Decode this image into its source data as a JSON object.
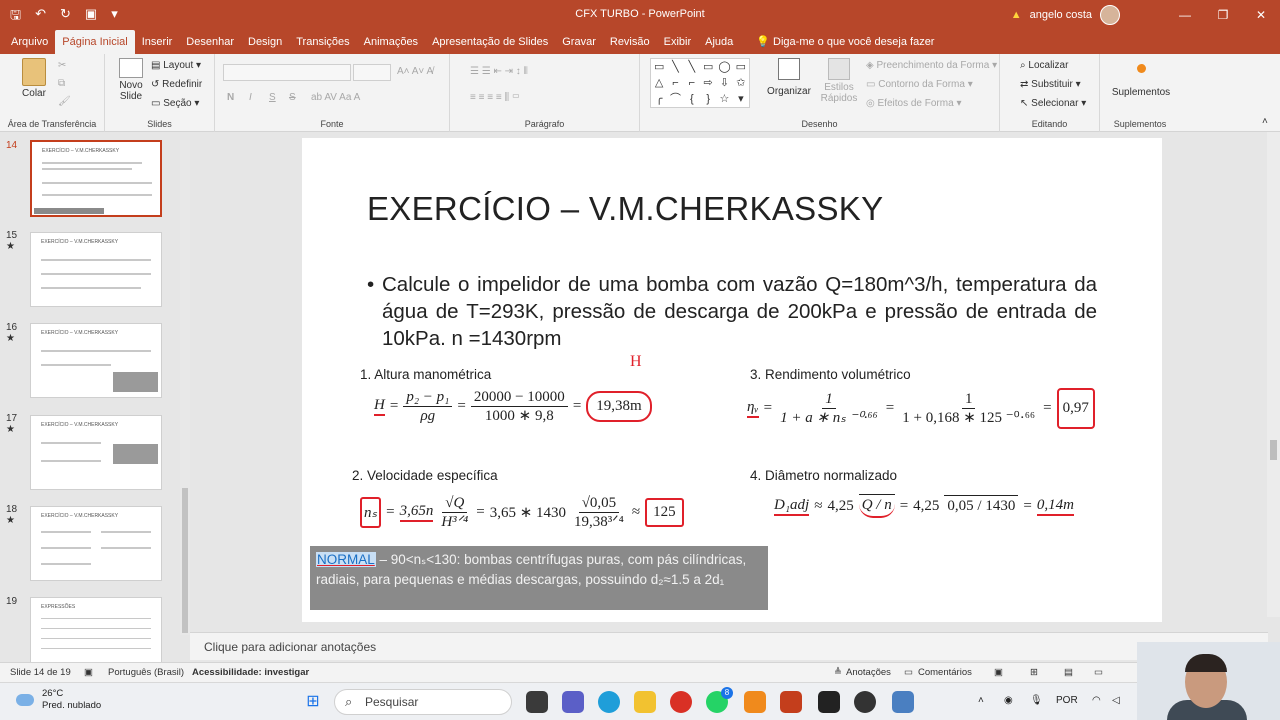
{
  "window": {
    "title": "CFX TURBO  -  PowerPoint",
    "user_name": "angelo costa"
  },
  "tabs": [
    {
      "label": "Arquivo"
    },
    {
      "label": "Página Inicial"
    },
    {
      "label": "Inserir"
    },
    {
      "label": "Desenhar"
    },
    {
      "label": "Design"
    },
    {
      "label": "Transições"
    },
    {
      "label": "Animações"
    },
    {
      "label": "Apresentação de Slides"
    },
    {
      "label": "Gravar"
    },
    {
      "label": "Revisão"
    },
    {
      "label": "Exibir"
    },
    {
      "label": "Ajuda"
    }
  ],
  "tell_me": "Diga-me o que você deseja fazer",
  "ribbon": {
    "clipboard": {
      "paste": "Colar",
      "group": "Área de Transferência"
    },
    "slides": {
      "new_slide": "Novo Slide",
      "layout": "Layout",
      "reset": "Redefinir",
      "section": "Seção",
      "group": "Slides"
    },
    "font": {
      "group": "Fonte",
      "bold": "N",
      "italic": "I",
      "underline": "S",
      "strike": "S"
    },
    "paragraph": {
      "group": "Parágrafo"
    },
    "drawing": {
      "arrange": "Organizar",
      "quick_styles": "Estilos Rápidos",
      "fill": "Preenchimento da Forma",
      "outline": "Contorno da Forma",
      "effects": "Efeitos de Forma",
      "group": "Desenho"
    },
    "editing": {
      "find": "Localizar",
      "replace": "Substituir",
      "select": "Selecionar",
      "group": "Editando"
    },
    "addins": {
      "label": "Suplementos",
      "group": "Suplementos"
    }
  },
  "thumbnails": [
    {
      "number": "14",
      "title": "EXERCÍCIO – V.M.CHERKASSKY"
    },
    {
      "number": "15",
      "title": "EXERCÍCIO – V.M.CHERKASSKY"
    },
    {
      "number": "16",
      "title": "EXERCÍCIO – V.M.CHERKASSKY"
    },
    {
      "number": "17",
      "title": "EXERCÍCIO – V.M.CHERKASSKY"
    },
    {
      "number": "18",
      "title": "EXERCÍCIO – V.M.CHERKASSKY"
    },
    {
      "number": "19",
      "title": "EXPRESSÕES"
    }
  ],
  "slide": {
    "title": "EXERCÍCIO – V.M.CHERKASSKY",
    "bullet": "Calcule o impelidor de uma bomba com vazão Q=180m^3/h, temperatura da água de T=293K, pressão de descarga de 200kPa e pressão de entrada de 10kPa. n =1430rpm",
    "sec1": "1. Altura manométrica",
    "sec2": "2. Velocidade específica",
    "sec3": "3. Rendimento volumétrico",
    "sec4": "4. Diâmetro normalizado",
    "eq1": {
      "lhs": "H",
      "num1": "p₂ − p₁",
      "den1": "ρg",
      "num2": "20000 − 10000",
      "den2": "1000 ∗ 9,8",
      "result": "19,38m"
    },
    "eq2": {
      "lhs": "nₛ",
      "mid": "3,65n",
      "num": "√Q",
      "den": "H³ᐟ⁴",
      "num2": "√0,05",
      "den2": "19,38³ᐟ⁴",
      "const": "3,65 ∗ 1430",
      "result": "125"
    },
    "eq3": {
      "lhs": "ηᵥ",
      "num": "1",
      "den": "1 + a ∗ nₛ ⁻⁰·⁶⁶",
      "den2": "1 + 0,168 ∗ 125 ⁻⁰·⁶⁶",
      "result": "0,97"
    },
    "eq4": {
      "lhs": "D₁adj",
      "c": "4,25",
      "root1": "Q / n",
      "root2": "0,05 / 1430",
      "result": "0,14m"
    },
    "note_highlight": "NORMAL",
    "note_text": " – 90<nₛ<130: bombas centrífugas puras, com pás cilíndricas, radiais, para pequenas e médias descargas, possuindo d₂≈1.5 a 2d₁",
    "annotation_mark": "H"
  },
  "notes_placeholder": "Clique para adicionar anotações",
  "status": {
    "slide_of": "Slide 14 de 19",
    "language": "Português (Brasil)",
    "accessibility": "Acessibilidade: investigar",
    "notes": "Anotações",
    "comments": "Comentários"
  },
  "taskbar": {
    "temperature": "26°C",
    "weather": "Pred. nublado",
    "search": "Pesquisar",
    "whatsapp_badge": "8",
    "lang": "POR"
  }
}
